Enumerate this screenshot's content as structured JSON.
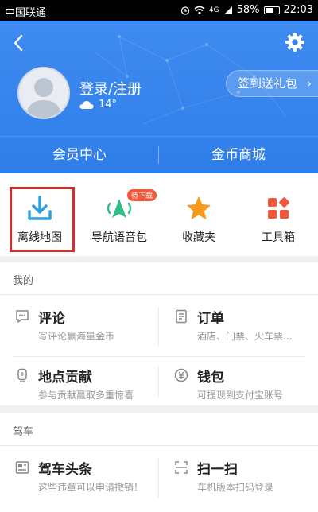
{
  "status_bar": {
    "carrier": "中国联通",
    "network": "4G",
    "battery": "58%",
    "time": "22:03"
  },
  "header": {
    "login_label": "登录/注册",
    "temperature": "14°",
    "gift_button": "签到送礼包",
    "tabs": [
      "会员中心",
      "金币商城"
    ]
  },
  "quick_items": [
    {
      "label": "离线地图",
      "icon": "download-icon",
      "color": "#2a9fe0"
    },
    {
      "label": "导航语音包",
      "icon": "voice-nav-icon",
      "color": "#2ebf86",
      "badge": "待下载"
    },
    {
      "label": "收藏夹",
      "icon": "star-icon",
      "color": "#f59a1b"
    },
    {
      "label": "工具箱",
      "icon": "toolbox-icon",
      "color": "#f05a3a"
    }
  ],
  "mine": {
    "title": "我的",
    "cells": [
      {
        "title": "评论",
        "subtitle": "写评论赢海量金币",
        "icon": "comment-icon"
      },
      {
        "title": "订单",
        "subtitle": "酒店、门票、火车票...",
        "icon": "order-icon"
      },
      {
        "title": "地点贡献",
        "subtitle": "参与贡献赢取多重惊喜",
        "icon": "location-icon"
      },
      {
        "title": "钱包",
        "subtitle": "可提现到支付宝账号",
        "icon": "wallet-icon"
      }
    ]
  },
  "drive": {
    "title": "驾车",
    "cells": [
      {
        "title": "驾车头条",
        "subtitle": "这些违章可以申请撤销！",
        "icon": "news-icon"
      },
      {
        "title": "扫一扫",
        "subtitle": "车机版本扫码登录",
        "icon": "scan-icon"
      }
    ]
  }
}
